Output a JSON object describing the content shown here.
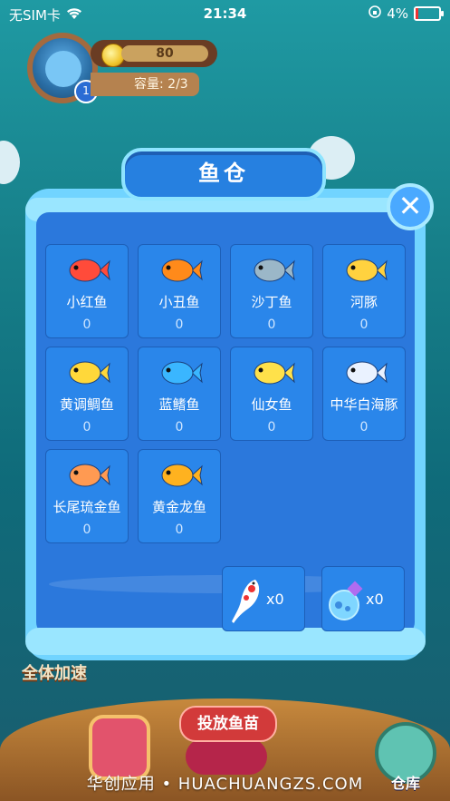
{
  "status_bar": {
    "carrier": "无SIM卡",
    "time": "21:34",
    "battery": "4%"
  },
  "profile": {
    "level": "1",
    "coins": "80",
    "capacity": "容量: 2/3"
  },
  "dialog": {
    "title": "鱼仓",
    "close_icon": "close-icon",
    "fish": [
      {
        "name": "小红鱼",
        "count": "0",
        "color": "#ff4b3a"
      },
      {
        "name": "小丑鱼",
        "count": "0",
        "color": "#ff8a1a"
      },
      {
        "name": "沙丁鱼",
        "count": "0",
        "color": "#9bb7c8"
      },
      {
        "name": "河豚",
        "count": "0",
        "color": "#ffd23f"
      },
      {
        "name": "黄调鲷鱼",
        "count": "0",
        "color": "#ffd83a"
      },
      {
        "name": "蓝鳍鱼",
        "count": "0",
        "color": "#3ab6ff"
      },
      {
        "name": "仙女鱼",
        "count": "0",
        "color": "#ffe14a"
      },
      {
        "name": "中华白海豚",
        "count": "0",
        "color": "#eaf2ff"
      },
      {
        "name": "长尾琉金鱼",
        "count": "0",
        "color": "#ff9a52"
      },
      {
        "name": "黄金龙鱼",
        "count": "0",
        "color": "#ffb21f"
      }
    ],
    "items": [
      {
        "icon": "koi-icon",
        "qty": "x0"
      },
      {
        "icon": "potion-icon",
        "qty": "x0"
      }
    ]
  },
  "bottom": {
    "speedup_label": "全体加速",
    "release_label": "投放鱼苗",
    "warehouse_label": "仓库",
    "watermark": "华创应用 • HUACHUANGZS.COM"
  }
}
